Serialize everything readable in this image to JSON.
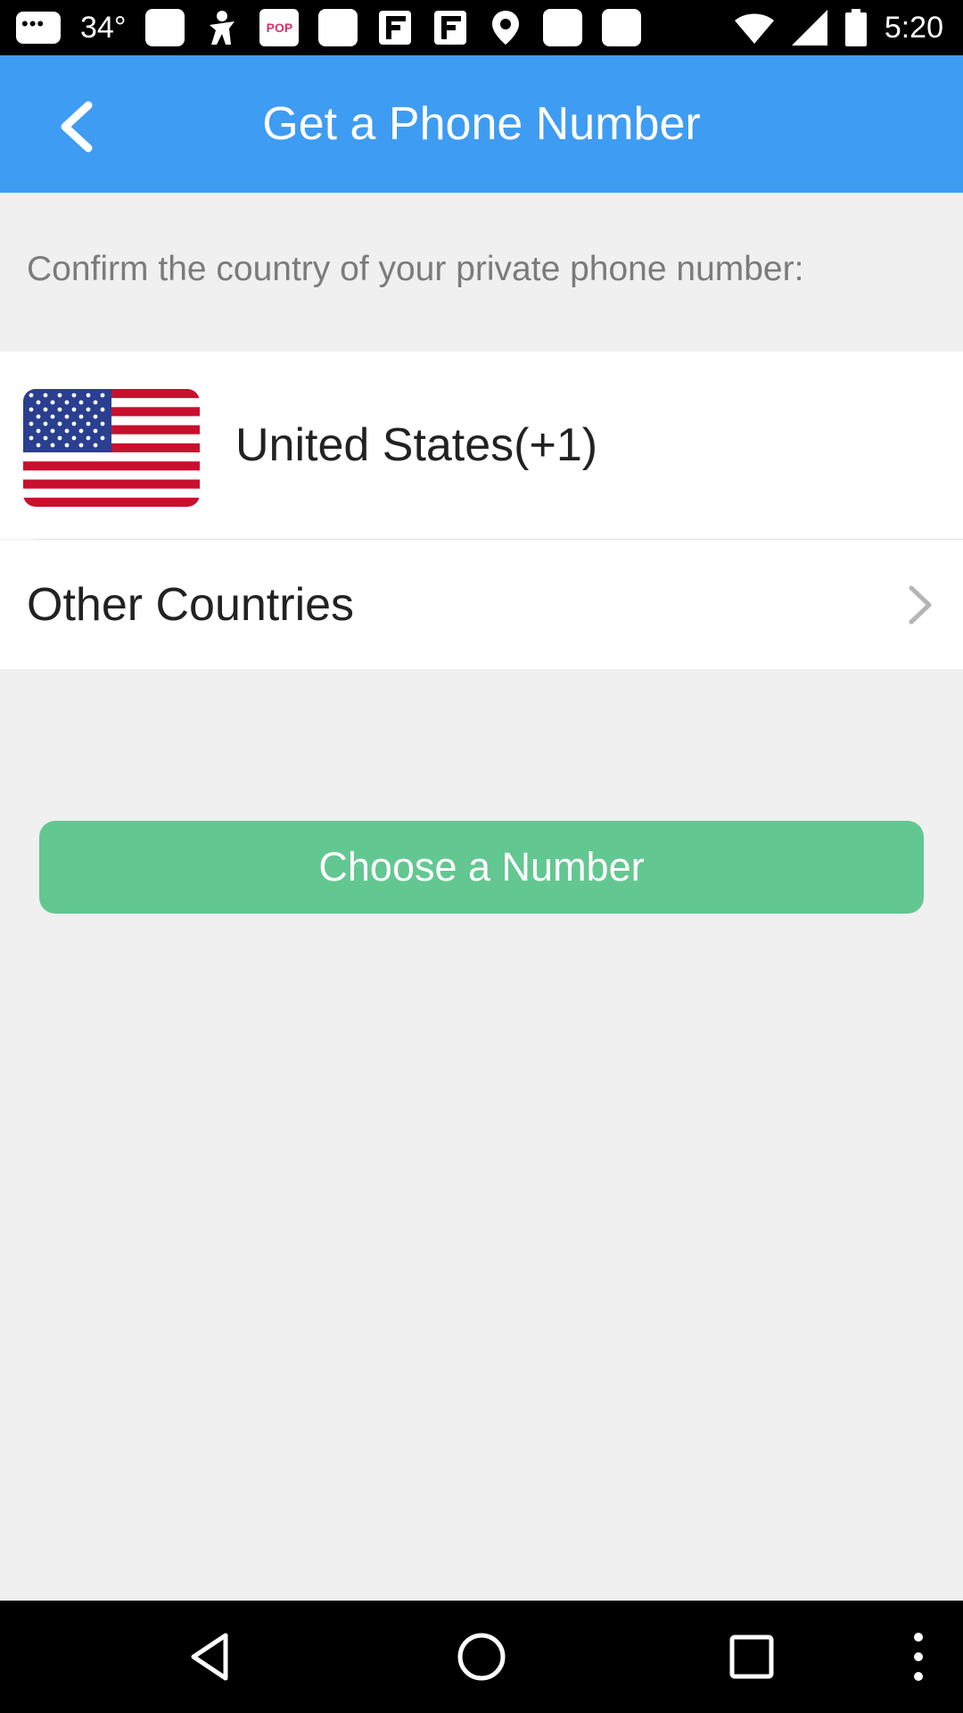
{
  "status_bar": {
    "temperature": "34°",
    "time": "5:20"
  },
  "header": {
    "title": "Get a Phone Number",
    "back_icon": "chevron-left-icon"
  },
  "instruction": "Confirm the country of your private phone number:",
  "selected_country": {
    "label": "United States(+1)",
    "flag": "us-flag"
  },
  "other_countries": {
    "label": "Other Countries",
    "icon": "chevron-right-icon"
  },
  "choose_button": {
    "label": "Choose a Number"
  },
  "colors": {
    "header_bg": "#3f9cf3",
    "button_bg": "#63c791",
    "page_bg": "#f0f0f0"
  },
  "nav_bar": {
    "icons": [
      "back-icon",
      "home-icon",
      "recents-icon",
      "more-icon"
    ]
  }
}
